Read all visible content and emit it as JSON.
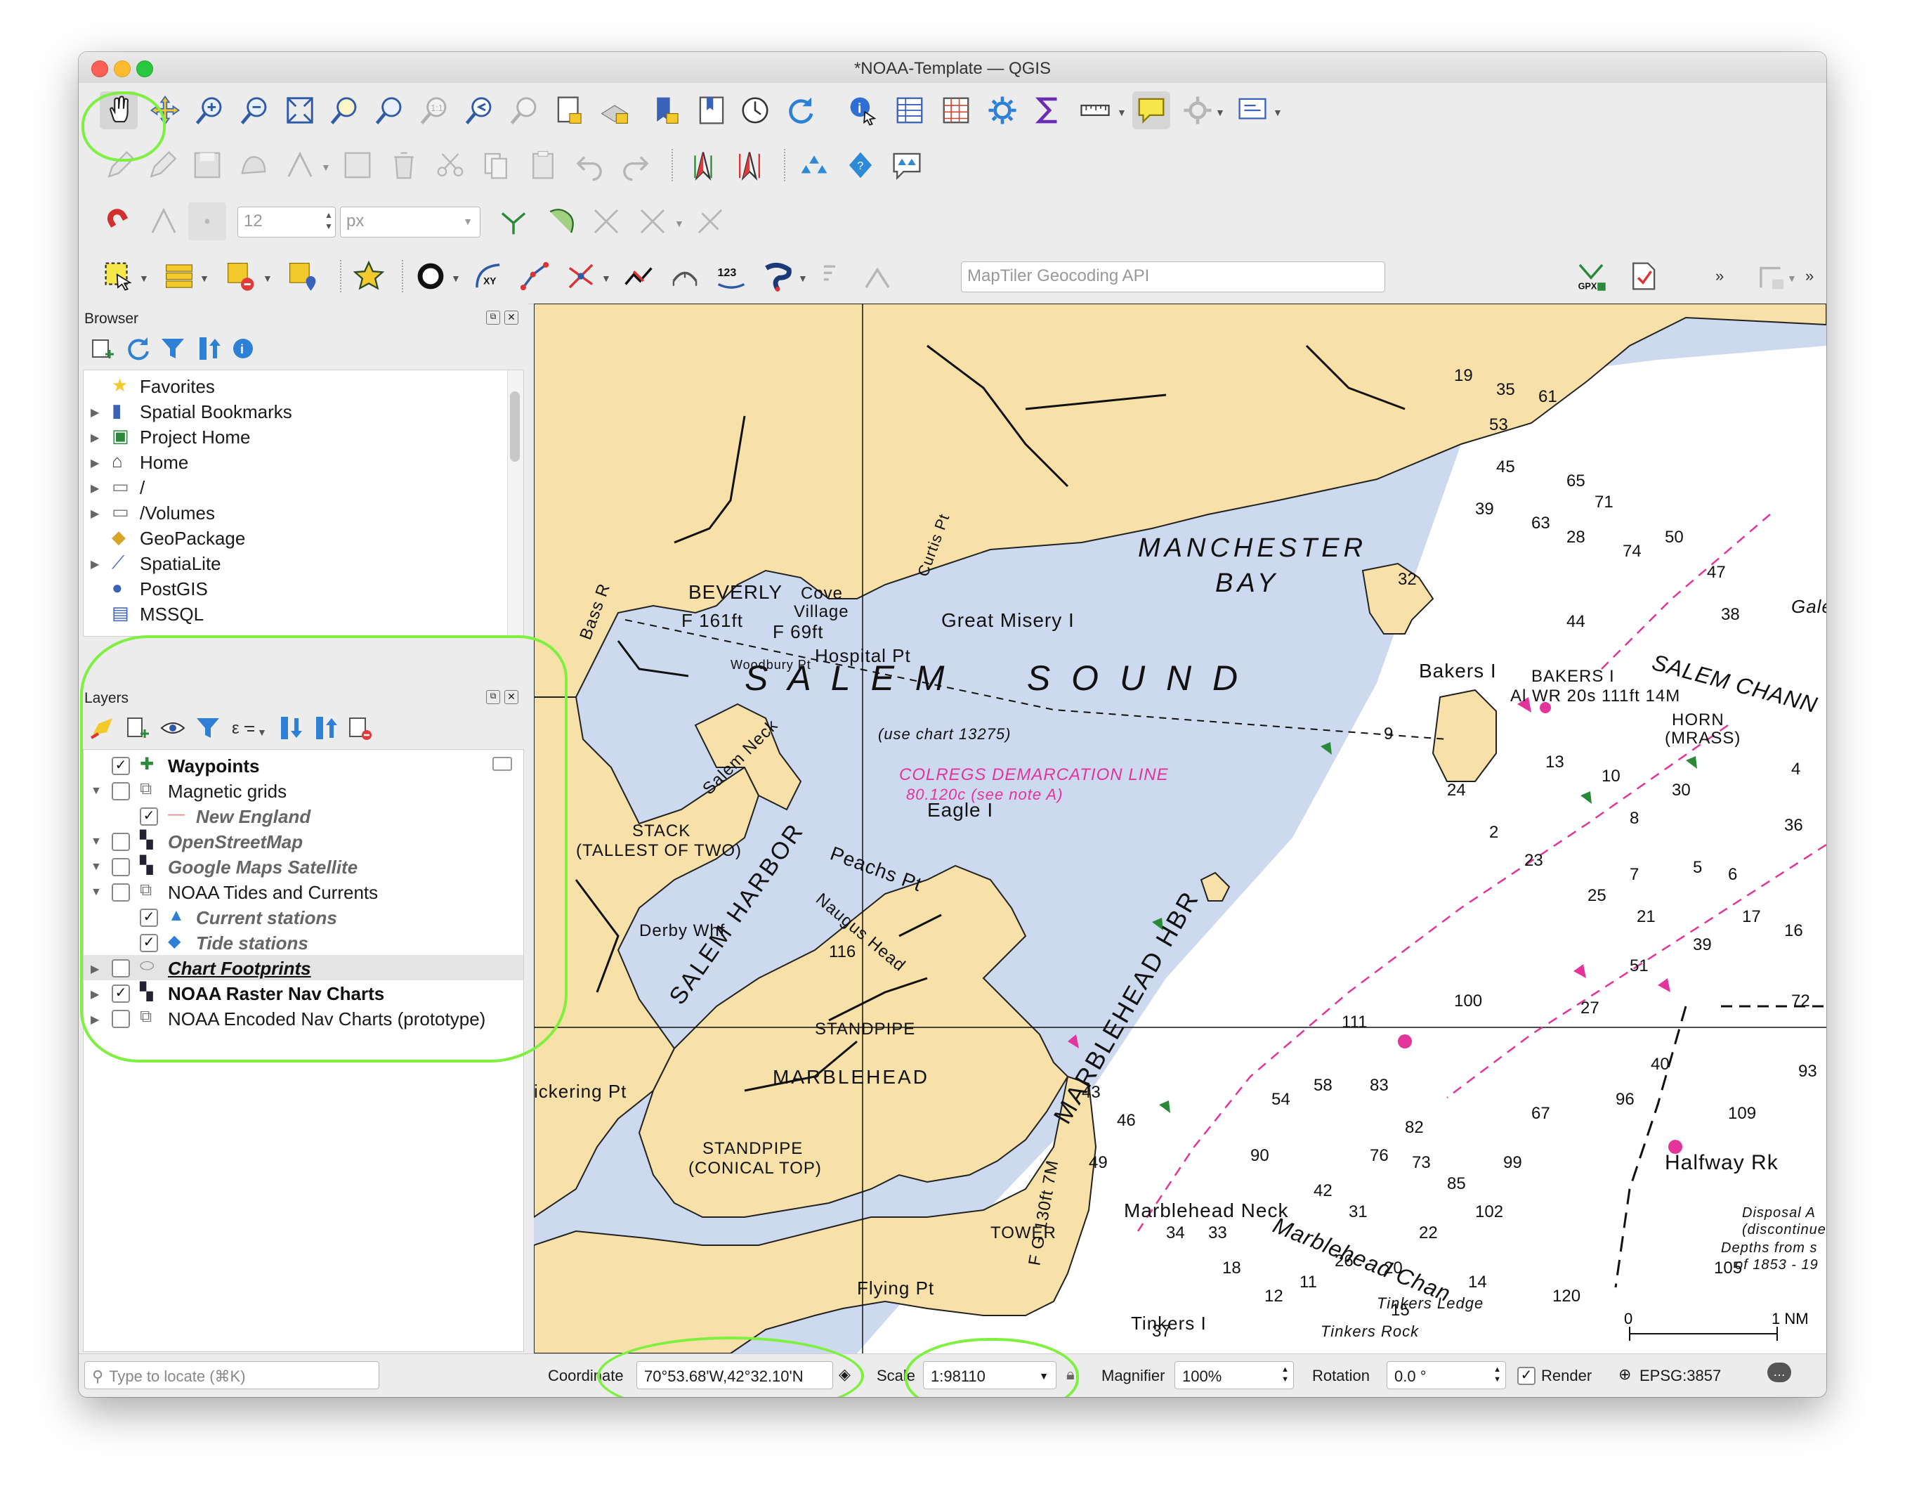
{
  "window": {
    "title": "*NOAA-Template — QGIS"
  },
  "toolbar": {
    "geocoder_placeholder": "MapTiler Geocoding API",
    "snap_tolerance_value": "12",
    "snap_units": "px",
    "label_123": "123",
    "label_xy": "XY",
    "label_gpx": "GPX",
    "overflow_1": "»",
    "overflow_2": "»"
  },
  "browser": {
    "title": "Browser",
    "items": [
      {
        "label": "Favorites",
        "icon": "star-icon",
        "expandable": false
      },
      {
        "label": "Spatial Bookmarks",
        "icon": "bookmark-icon",
        "expandable": true
      },
      {
        "label": "Project Home",
        "icon": "project-home-icon",
        "expandable": true
      },
      {
        "label": "Home",
        "icon": "home-icon",
        "expandable": true
      },
      {
        "label": "/",
        "icon": "folder-icon",
        "expandable": true
      },
      {
        "label": "/Volumes",
        "icon": "folder-icon",
        "expandable": true
      },
      {
        "label": "GeoPackage",
        "icon": "geopackage-icon",
        "expandable": false
      },
      {
        "label": "SpatiaLite",
        "icon": "feather-icon",
        "expandable": true
      },
      {
        "label": "PostGIS",
        "icon": "elephant-icon",
        "expandable": false
      },
      {
        "label": "MSSQL",
        "icon": "database-icon",
        "expandable": false
      }
    ]
  },
  "layers": {
    "title": "Layers",
    "items": [
      {
        "label": "Waypoints",
        "checked": true,
        "bold": true,
        "italic": false,
        "indent": 0,
        "arrow": "",
        "icon": "point-layer-icon"
      },
      {
        "label": "Magnetic grids",
        "checked": false,
        "bold": false,
        "italic": false,
        "indent": 0,
        "arrow": "down",
        "icon": "group-icon"
      },
      {
        "label": "New England",
        "checked": true,
        "bold": true,
        "italic": true,
        "indent": 1,
        "arrow": "",
        "icon": "line-layer-icon"
      },
      {
        "label": "OpenStreetMap",
        "checked": false,
        "bold": true,
        "italic": true,
        "indent": 0,
        "arrow": "down",
        "icon": "raster-layer-icon"
      },
      {
        "label": "Google Maps Satellite",
        "checked": false,
        "bold": true,
        "italic": true,
        "indent": 0,
        "arrow": "down",
        "icon": "raster-layer-icon"
      },
      {
        "label": "NOAA Tides and Currents",
        "checked": false,
        "bold": false,
        "italic": false,
        "indent": 0,
        "arrow": "down",
        "icon": "group-icon"
      },
      {
        "label": "Current stations",
        "checked": true,
        "bold": true,
        "italic": true,
        "indent": 1,
        "arrow": "",
        "icon": "triangle-layer-icon"
      },
      {
        "label": "Tide stations",
        "checked": true,
        "bold": true,
        "italic": true,
        "indent": 1,
        "arrow": "",
        "icon": "diamond-layer-icon"
      },
      {
        "label": "Chart Footprints",
        "checked": false,
        "bold": true,
        "italic": true,
        "indent": 0,
        "arrow": "right",
        "icon": "polygon-layer-icon"
      },
      {
        "label": "NOAA Raster Nav Charts",
        "checked": true,
        "bold": true,
        "italic": false,
        "indent": 0,
        "arrow": "right",
        "icon": "raster-layer-icon"
      },
      {
        "label": "NOAA Encoded Nav Charts (prototype)",
        "checked": false,
        "bold": false,
        "italic": false,
        "indent": 0,
        "arrow": "right",
        "icon": "group-icon"
      }
    ]
  },
  "map": {
    "labels": {
      "beverly": "BEVERLY",
      "manchester": "MANCHESTER",
      "bay": "BAY",
      "salem_sound": "S A L E M     S O U N D",
      "use_chart": "(use chart 13275)",
      "colregs1": "COLREGS DEMARCATION LINE",
      "colregs2": "80.120c (see note A)",
      "great_misery": "Great Misery I",
      "eagle": "Eagle I",
      "bakers": "Bakers I",
      "salem_harbor": "SALEM HARBOR",
      "marblehead_hbr": "MARBLEHEAD HBR",
      "marblehead": "MARBLEHEAD",
      "standpipe": "STANDPIPE",
      "standpipe_conical1": "STANDPIPE",
      "standpipe_conical2": "(CONICAL TOP)",
      "salem_neck": "Salem Neck",
      "stack1": "STACK",
      "stack2": "(TALLEST OF TWO)",
      "derby": "Derby Whf",
      "peach": "Peachs Pt",
      "naugus": "Naugus Head",
      "cove1": "Cove",
      "cove2": "Village",
      "hospital": "Hospital Pt",
      "woodbury": "Woodbury Pt",
      "curtis": "Curtis Pt",
      "bass": "Bass R",
      "f161": "F 161ft",
      "f69": "F 69ft",
      "halfway": "Halfway Rk",
      "marblehead_neck": "Marblehead Neck",
      "marblehead_chan": "Marblehead Chan",
      "tinkers_ledge": "Tinkers Ledge",
      "tinkers_rock": "Tinkers Rock",
      "tinkers": "Tinkers I",
      "flying": "Flying Pt",
      "tower": "TOWER",
      "fg130": "F G 130ft 7M",
      "pickering": "ickering Pt",
      "salem_chan": "SALEM CHANN",
      "gales": "Gales Led",
      "bakers_bell": "BAKERS I",
      "al_wr": "Al WR 20s 111ft 14M",
      "horn": "HORN",
      "mrass": "(MRASS)",
      "disposal": "Disposal A",
      "discontinue": "(discontinue",
      "depths": "Depths from s",
      "of1853": "of 1853 - 19",
      "scalebar_0": "0",
      "scalebar_1": "1 NM",
      "soundings": [
        "19",
        "35",
        "61",
        "53",
        "45",
        "39",
        "65",
        "71",
        "74",
        "50",
        "47",
        "38",
        "28",
        "63",
        "44",
        "32",
        "9",
        "24",
        "13",
        "10",
        "8",
        "7",
        "5",
        "6",
        "4",
        "36",
        "30",
        "2",
        "23",
        "25",
        "21",
        "39",
        "17",
        "16",
        "51",
        "27",
        "40",
        "72",
        "93",
        "96",
        "67",
        "99",
        "85",
        "102",
        "76",
        "73",
        "42",
        "31",
        "26",
        "20",
        "22",
        "14",
        "15",
        "11",
        "12",
        "18",
        "33",
        "34",
        "37",
        "43",
        "46",
        "49",
        "54",
        "58",
        "83",
        "82",
        "90",
        "111",
        "120",
        "105",
        "109",
        "100",
        "116"
      ]
    }
  },
  "status": {
    "locate_placeholder": "Type to locate (⌘K)",
    "coordinate_label": "Coordinate",
    "coordinate_value": "70°53.68'W,42°32.10'N",
    "scale_label": "Scale",
    "scale_value": "1:98110",
    "magnifier_label": "Magnifier",
    "magnifier_value": "100%",
    "rotation_label": "Rotation",
    "rotation_value": "0.0 °",
    "render_label": "Render",
    "render_checked": true,
    "crs": "EPSG:3857"
  },
  "colors": {
    "land": "#f7e1a8",
    "water_shallow": "#cdd9ee",
    "water_deep": "#ffffff",
    "magenta": "#e2349a",
    "highlight_green": "#7ef03f"
  }
}
